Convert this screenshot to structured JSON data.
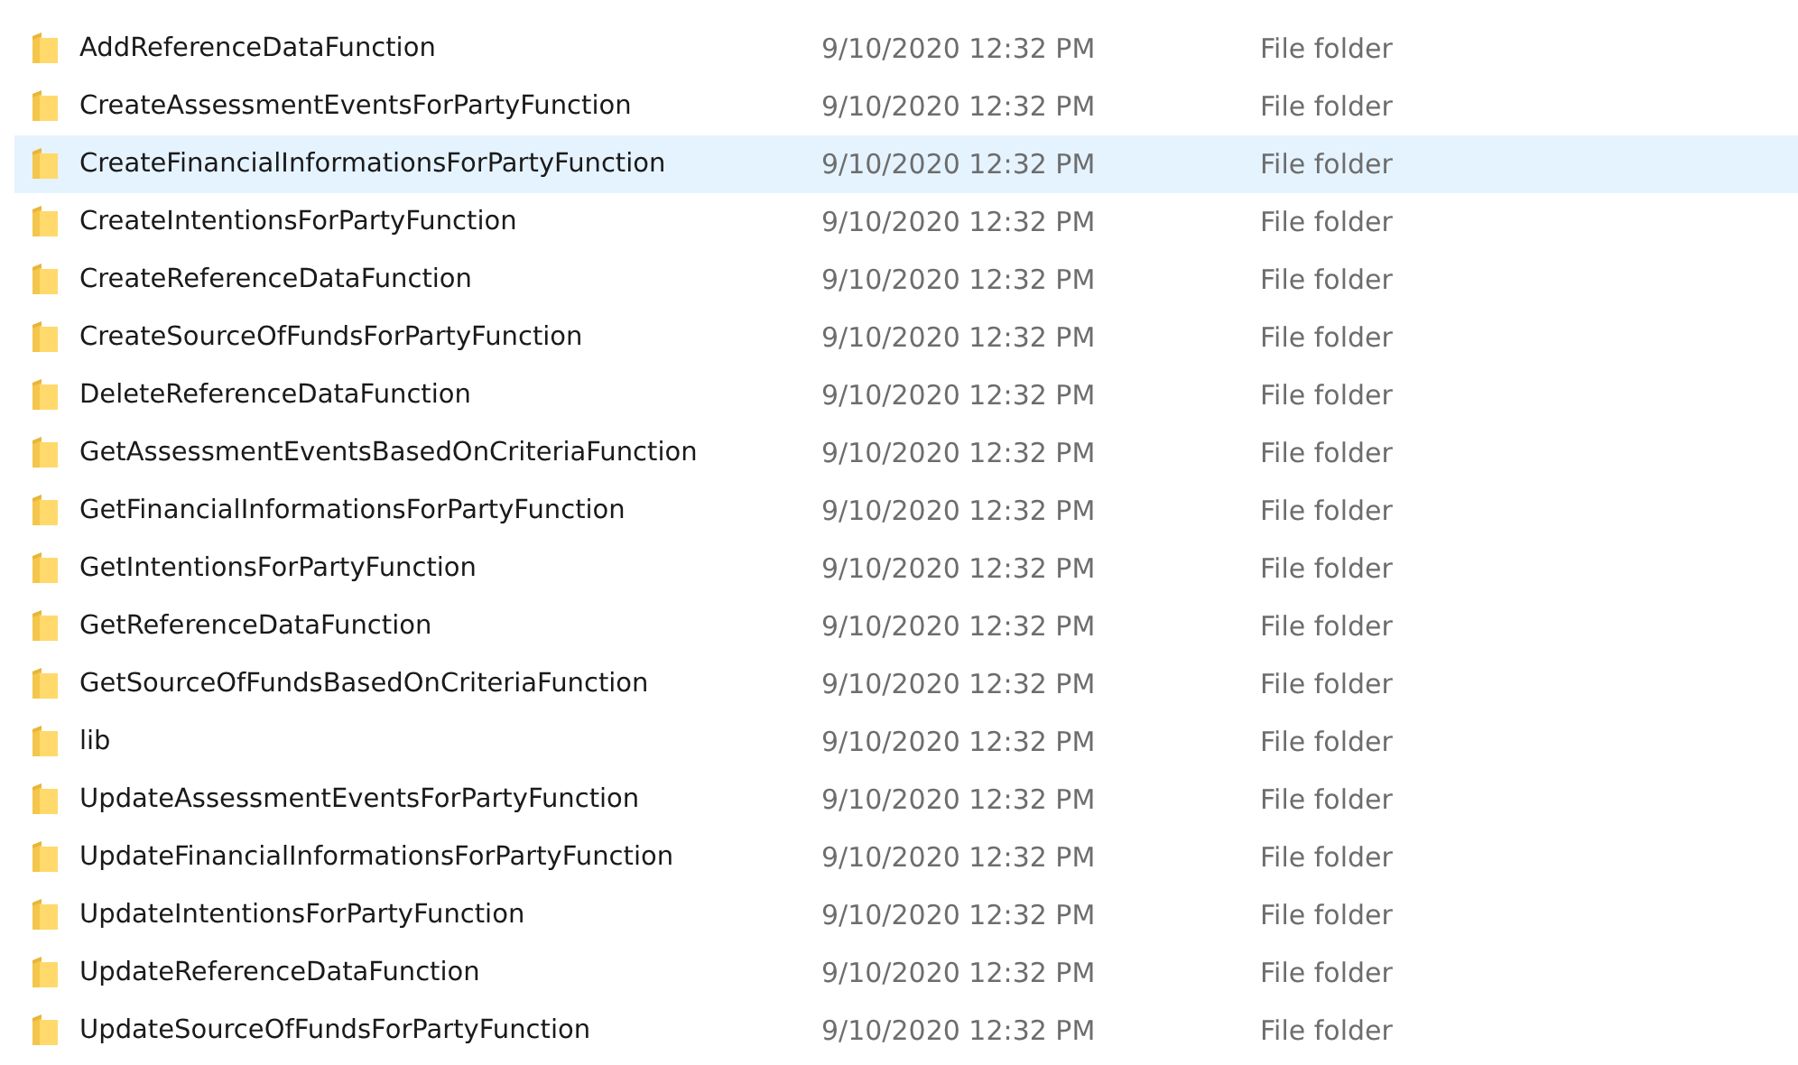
{
  "files": [
    {
      "name": "AddReferenceDataFunction",
      "date": "9/10/2020 12:32 PM",
      "type": "File folder",
      "selected": false
    },
    {
      "name": "CreateAssessmentEventsForPartyFunction",
      "date": "9/10/2020 12:32 PM",
      "type": "File folder",
      "selected": false
    },
    {
      "name": "CreateFinancialInformationsForPartyFunction",
      "date": "9/10/2020 12:32 PM",
      "type": "File folder",
      "selected": true
    },
    {
      "name": "CreateIntentionsForPartyFunction",
      "date": "9/10/2020 12:32 PM",
      "type": "File folder",
      "selected": false
    },
    {
      "name": "CreateReferenceDataFunction",
      "date": "9/10/2020 12:32 PM",
      "type": "File folder",
      "selected": false
    },
    {
      "name": "CreateSourceOfFundsForPartyFunction",
      "date": "9/10/2020 12:32 PM",
      "type": "File folder",
      "selected": false
    },
    {
      "name": "DeleteReferenceDataFunction",
      "date": "9/10/2020 12:32 PM",
      "type": "File folder",
      "selected": false
    },
    {
      "name": "GetAssessmentEventsBasedOnCriteriaFunction",
      "date": "9/10/2020 12:32 PM",
      "type": "File folder",
      "selected": false
    },
    {
      "name": "GetFinancialInformationsForPartyFunction",
      "date": "9/10/2020 12:32 PM",
      "type": "File folder",
      "selected": false
    },
    {
      "name": "GetIntentionsForPartyFunction",
      "date": "9/10/2020 12:32 PM",
      "type": "File folder",
      "selected": false
    },
    {
      "name": "GetReferenceDataFunction",
      "date": "9/10/2020 12:32 PM",
      "type": "File folder",
      "selected": false
    },
    {
      "name": "GetSourceOfFundsBasedOnCriteriaFunction",
      "date": "9/10/2020 12:32 PM",
      "type": "File folder",
      "selected": false
    },
    {
      "name": "lib",
      "date": "9/10/2020 12:32 PM",
      "type": "File folder",
      "selected": false
    },
    {
      "name": "UpdateAssessmentEventsForPartyFunction",
      "date": "9/10/2020 12:32 PM",
      "type": "File folder",
      "selected": false
    },
    {
      "name": "UpdateFinancialInformationsForPartyFunction",
      "date": "9/10/2020 12:32 PM",
      "type": "File folder",
      "selected": false
    },
    {
      "name": "UpdateIntentionsForPartyFunction",
      "date": "9/10/2020 12:32 PM",
      "type": "File folder",
      "selected": false
    },
    {
      "name": "UpdateReferenceDataFunction",
      "date": "9/10/2020 12:32 PM",
      "type": "File folder",
      "selected": false
    },
    {
      "name": "UpdateSourceOfFundsForPartyFunction",
      "date": "9/10/2020 12:32 PM",
      "type": "File folder",
      "selected": false
    }
  ]
}
